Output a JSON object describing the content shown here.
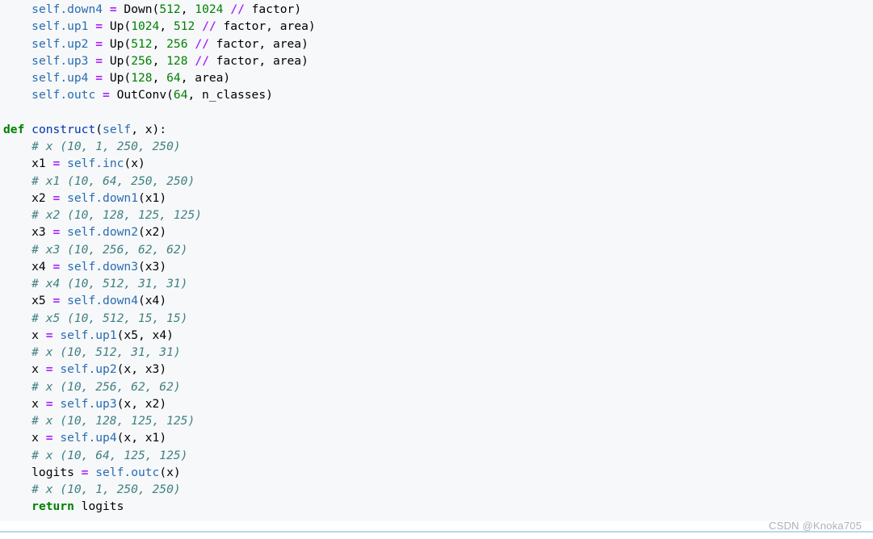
{
  "code": {
    "lines": [
      [
        {
          "t": "    ",
          "c": "plain"
        },
        {
          "t": "self",
          "c": "self"
        },
        {
          "t": ".down4 ",
          "c": "attr"
        },
        {
          "t": "=",
          "c": "op"
        },
        {
          "t": " Down(",
          "c": "plain"
        },
        {
          "t": "512",
          "c": "num"
        },
        {
          "t": ", ",
          "c": "plain"
        },
        {
          "t": "1024",
          "c": "num"
        },
        {
          "t": " ",
          "c": "plain"
        },
        {
          "t": "//",
          "c": "op"
        },
        {
          "t": " factor)",
          "c": "plain"
        }
      ],
      [
        {
          "t": "    ",
          "c": "plain"
        },
        {
          "t": "self",
          "c": "self"
        },
        {
          "t": ".up1 ",
          "c": "attr"
        },
        {
          "t": "=",
          "c": "op"
        },
        {
          "t": " Up(",
          "c": "plain"
        },
        {
          "t": "1024",
          "c": "num"
        },
        {
          "t": ", ",
          "c": "plain"
        },
        {
          "t": "512",
          "c": "num"
        },
        {
          "t": " ",
          "c": "plain"
        },
        {
          "t": "//",
          "c": "op"
        },
        {
          "t": " factor, area)",
          "c": "plain"
        }
      ],
      [
        {
          "t": "    ",
          "c": "plain"
        },
        {
          "t": "self",
          "c": "self"
        },
        {
          "t": ".up2 ",
          "c": "attr"
        },
        {
          "t": "=",
          "c": "op"
        },
        {
          "t": " Up(",
          "c": "plain"
        },
        {
          "t": "512",
          "c": "num"
        },
        {
          "t": ", ",
          "c": "plain"
        },
        {
          "t": "256",
          "c": "num"
        },
        {
          "t": " ",
          "c": "plain"
        },
        {
          "t": "//",
          "c": "op"
        },
        {
          "t": " factor, area)",
          "c": "plain"
        }
      ],
      [
        {
          "t": "    ",
          "c": "plain"
        },
        {
          "t": "self",
          "c": "self"
        },
        {
          "t": ".up3 ",
          "c": "attr"
        },
        {
          "t": "=",
          "c": "op"
        },
        {
          "t": " Up(",
          "c": "plain"
        },
        {
          "t": "256",
          "c": "num"
        },
        {
          "t": ", ",
          "c": "plain"
        },
        {
          "t": "128",
          "c": "num"
        },
        {
          "t": " ",
          "c": "plain"
        },
        {
          "t": "//",
          "c": "op"
        },
        {
          "t": " factor, area)",
          "c": "plain"
        }
      ],
      [
        {
          "t": "    ",
          "c": "plain"
        },
        {
          "t": "self",
          "c": "self"
        },
        {
          "t": ".up4 ",
          "c": "attr"
        },
        {
          "t": "=",
          "c": "op"
        },
        {
          "t": " Up(",
          "c": "plain"
        },
        {
          "t": "128",
          "c": "num"
        },
        {
          "t": ", ",
          "c": "plain"
        },
        {
          "t": "64",
          "c": "num"
        },
        {
          "t": ", area)",
          "c": "plain"
        }
      ],
      [
        {
          "t": "    ",
          "c": "plain"
        },
        {
          "t": "self",
          "c": "self"
        },
        {
          "t": ".outc ",
          "c": "attr"
        },
        {
          "t": "=",
          "c": "op"
        },
        {
          "t": " OutConv(",
          "c": "plain"
        },
        {
          "t": "64",
          "c": "num"
        },
        {
          "t": ", n_classes)",
          "c": "plain"
        }
      ],
      [],
      [
        {
          "t": "def",
          "c": "kw"
        },
        {
          "t": " ",
          "c": "plain"
        },
        {
          "t": "construct",
          "c": "fn"
        },
        {
          "t": "(",
          "c": "plain"
        },
        {
          "t": "self",
          "c": "self"
        },
        {
          "t": ", x):",
          "c": "plain"
        }
      ],
      [
        {
          "t": "    ",
          "c": "plain"
        },
        {
          "t": "# x (10, 1, 250, 250)",
          "c": "comment"
        }
      ],
      [
        {
          "t": "    x1 ",
          "c": "plain"
        },
        {
          "t": "=",
          "c": "op"
        },
        {
          "t": " ",
          "c": "plain"
        },
        {
          "t": "self",
          "c": "self"
        },
        {
          "t": ".inc",
          "c": "attr"
        },
        {
          "t": "(x)",
          "c": "plain"
        }
      ],
      [
        {
          "t": "    ",
          "c": "plain"
        },
        {
          "t": "# x1 (10, 64, 250, 250)",
          "c": "comment"
        }
      ],
      [
        {
          "t": "    x2 ",
          "c": "plain"
        },
        {
          "t": "=",
          "c": "op"
        },
        {
          "t": " ",
          "c": "plain"
        },
        {
          "t": "self",
          "c": "self"
        },
        {
          "t": ".down1",
          "c": "attr"
        },
        {
          "t": "(x1)",
          "c": "plain"
        }
      ],
      [
        {
          "t": "    ",
          "c": "plain"
        },
        {
          "t": "# x2 (10, 128, 125, 125)",
          "c": "comment"
        }
      ],
      [
        {
          "t": "    x3 ",
          "c": "plain"
        },
        {
          "t": "=",
          "c": "op"
        },
        {
          "t": " ",
          "c": "plain"
        },
        {
          "t": "self",
          "c": "self"
        },
        {
          "t": ".down2",
          "c": "attr"
        },
        {
          "t": "(x2)",
          "c": "plain"
        }
      ],
      [
        {
          "t": "    ",
          "c": "plain"
        },
        {
          "t": "# x3 (10, 256, 62, 62)",
          "c": "comment"
        }
      ],
      [
        {
          "t": "    x4 ",
          "c": "plain"
        },
        {
          "t": "=",
          "c": "op"
        },
        {
          "t": " ",
          "c": "plain"
        },
        {
          "t": "self",
          "c": "self"
        },
        {
          "t": ".down3",
          "c": "attr"
        },
        {
          "t": "(x3)",
          "c": "plain"
        }
      ],
      [
        {
          "t": "    ",
          "c": "plain"
        },
        {
          "t": "# x4 (10, 512, 31, 31)",
          "c": "comment"
        }
      ],
      [
        {
          "t": "    x5 ",
          "c": "plain"
        },
        {
          "t": "=",
          "c": "op"
        },
        {
          "t": " ",
          "c": "plain"
        },
        {
          "t": "self",
          "c": "self"
        },
        {
          "t": ".down4",
          "c": "attr"
        },
        {
          "t": "(x4)",
          "c": "plain"
        }
      ],
      [
        {
          "t": "    ",
          "c": "plain"
        },
        {
          "t": "# x5 (10, 512, 15, 15)",
          "c": "comment"
        }
      ],
      [
        {
          "t": "    x ",
          "c": "plain"
        },
        {
          "t": "=",
          "c": "op"
        },
        {
          "t": " ",
          "c": "plain"
        },
        {
          "t": "self",
          "c": "self"
        },
        {
          "t": ".up1",
          "c": "attr"
        },
        {
          "t": "(x5, x4)",
          "c": "plain"
        }
      ],
      [
        {
          "t": "    ",
          "c": "plain"
        },
        {
          "t": "# x (10, 512, 31, 31)",
          "c": "comment"
        }
      ],
      [
        {
          "t": "    x ",
          "c": "plain"
        },
        {
          "t": "=",
          "c": "op"
        },
        {
          "t": " ",
          "c": "plain"
        },
        {
          "t": "self",
          "c": "self"
        },
        {
          "t": ".up2",
          "c": "attr"
        },
        {
          "t": "(x, x3)",
          "c": "plain"
        }
      ],
      [
        {
          "t": "    ",
          "c": "plain"
        },
        {
          "t": "# x (10, 256, 62, 62)",
          "c": "comment"
        }
      ],
      [
        {
          "t": "    x ",
          "c": "plain"
        },
        {
          "t": "=",
          "c": "op"
        },
        {
          "t": " ",
          "c": "plain"
        },
        {
          "t": "self",
          "c": "self"
        },
        {
          "t": ".up3",
          "c": "attr"
        },
        {
          "t": "(x, x2)",
          "c": "plain"
        }
      ],
      [
        {
          "t": "    ",
          "c": "plain"
        },
        {
          "t": "# x (10, 128, 125, 125)",
          "c": "comment"
        }
      ],
      [
        {
          "t": "    x ",
          "c": "plain"
        },
        {
          "t": "=",
          "c": "op"
        },
        {
          "t": " ",
          "c": "plain"
        },
        {
          "t": "self",
          "c": "self"
        },
        {
          "t": ".up4",
          "c": "attr"
        },
        {
          "t": "(x, x1)",
          "c": "plain"
        }
      ],
      [
        {
          "t": "    ",
          "c": "plain"
        },
        {
          "t": "# x (10, 64, 125, 125)",
          "c": "comment"
        }
      ],
      [
        {
          "t": "    logits ",
          "c": "plain"
        },
        {
          "t": "=",
          "c": "op"
        },
        {
          "t": " ",
          "c": "plain"
        },
        {
          "t": "self",
          "c": "self"
        },
        {
          "t": ".outc",
          "c": "attr"
        },
        {
          "t": "(x)",
          "c": "plain"
        }
      ],
      [
        {
          "t": "    ",
          "c": "plain"
        },
        {
          "t": "# x (10, 1, 250, 250)",
          "c": "comment"
        }
      ],
      [
        {
          "t": "    ",
          "c": "plain"
        },
        {
          "t": "return",
          "c": "kw"
        },
        {
          "t": " logits",
          "c": "plain"
        }
      ]
    ]
  },
  "watermark": {
    "text": "CSDN @Knoka705"
  },
  "colors": {
    "keyword": "#008000",
    "self": "#2a6cb0",
    "operator": "#aa22ff",
    "number": "#008000",
    "comment": "#408080",
    "function": "#0033b3",
    "background": "#f6f8fa"
  }
}
